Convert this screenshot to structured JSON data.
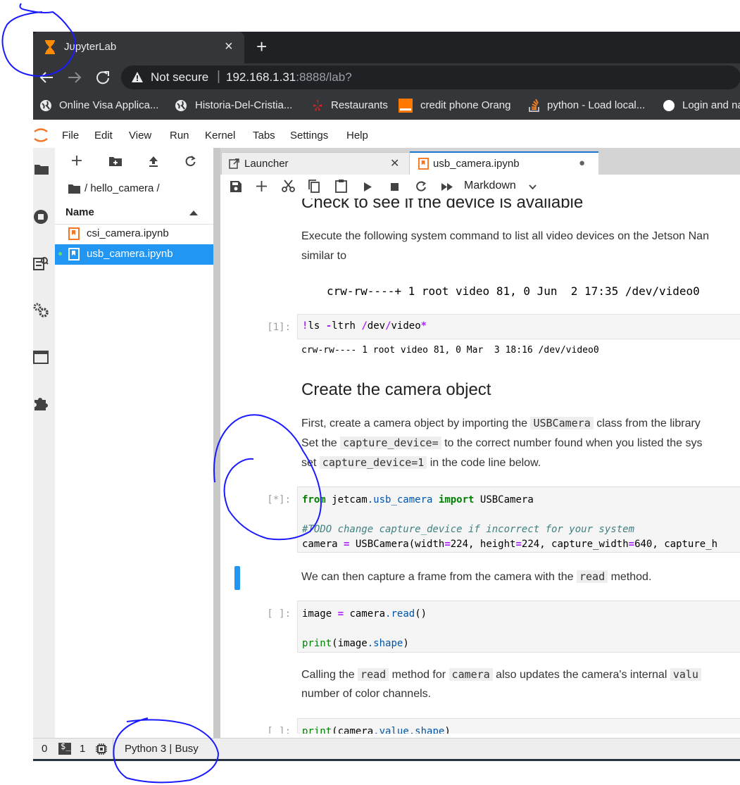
{
  "browser": {
    "tab_title": "JupyterLab",
    "tab_close": "×",
    "new_tab": "+",
    "not_secure": "Not secure",
    "url_host": "192.168.1.31",
    "url_rest": ":8888/lab?",
    "bookmarks": [
      {
        "label": "Online Visa Applica..."
      },
      {
        "label": "Historia-Del-Cristia..."
      },
      {
        "label": "Restaurants"
      },
      {
        "label": "credit phone Orang"
      },
      {
        "label": "python - Load local..."
      },
      {
        "label": "Login and na"
      }
    ],
    "colors": {
      "accent_tab_icon": "#ff8c00",
      "restaurants_icon": "#d32323",
      "orange_icon": "#ff7900"
    }
  },
  "menu": {
    "items": [
      "File",
      "Edit",
      "View",
      "Run",
      "Kernel",
      "Tabs",
      "Settings",
      "Help"
    ]
  },
  "filebrowser": {
    "toolbar_icons": [
      "plus-icon",
      "new-folder-icon",
      "upload-icon",
      "refresh-icon"
    ],
    "path": "/ hello_camera /",
    "column_name": "Name",
    "files": [
      {
        "name": "csi_camera.ipynb",
        "selected": false
      },
      {
        "name": "usb_camera.ipynb",
        "selected": true
      }
    ]
  },
  "tabs": [
    {
      "label": "Launcher",
      "close": "✕"
    },
    {
      "label": "usb_camera.ipynb",
      "close": "●"
    }
  ],
  "notebook_toolbar": {
    "cell_type": "Markdown"
  },
  "notebook": {
    "heading1": "Check to see if the device is available",
    "para1_line1": "Execute the following system command to list all video devices on the Jetson Nan",
    "para1_line2": "similar to",
    "code_block": "crw-rw----+ 1 root video 81, 0 Jun  2 17:35 /dev/video0",
    "cell1": {
      "prompt": "[1]:",
      "output": "crw-rw---- 1 root video 81, 0 Mar  3 18:16 /dev/video0"
    },
    "heading2": "Create the camera object",
    "para2": {
      "t1": "First, create a camera object by importing the ",
      "c1": "USBCamera",
      "t2": " class from the library",
      "t3": "Set the ",
      "c2": "capture_device=",
      "t4": " to the correct number found when you listed the sys",
      "t5": "set ",
      "c3": "capture_device=1",
      "t6": " in the code line below."
    },
    "cell2": {
      "prompt": "[*]:"
    },
    "para3": {
      "t1": "We can then capture a frame from the camera with the ",
      "c1": "read",
      "t2": " method."
    },
    "cell3": {
      "prompt": "[ ]:"
    },
    "para4": {
      "t1": "Calling the ",
      "c1": "read",
      "t2": " method for ",
      "c2": "camera",
      "t3": " also updates the camera's internal ",
      "c3": "valu",
      "line2": "number of color channels."
    },
    "cell4": {
      "prompt": "[ ]:"
    }
  },
  "statusbar": {
    "terminals": "0",
    "kernels": "1",
    "kernel_status": "Python 3 | Busy"
  },
  "colors": {
    "selection": "#2196f3",
    "active_cell_marker": "#2196f3",
    "tab_border": "#1976d2"
  }
}
